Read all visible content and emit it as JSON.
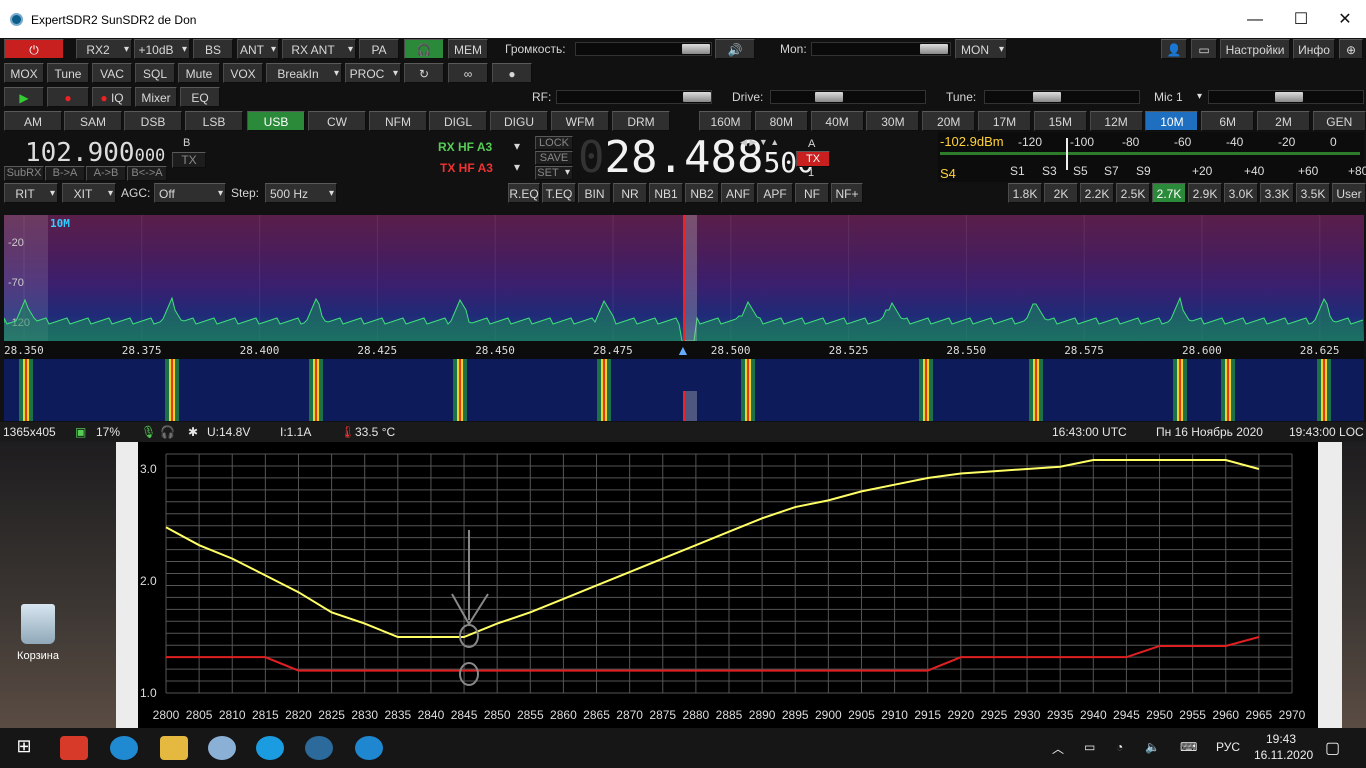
{
  "window": {
    "title": "ExpertSDR2 SunSDR2    de Don"
  },
  "row1": {
    "rx2": "RX2",
    "att": "+10dB",
    "bs": "BS",
    "ant": "ANT",
    "rxant": "RX ANT",
    "pa": "PA",
    "mem": "MEM",
    "volume_label": "Громкость:",
    "mon_label": "Mon:",
    "mon_btn": "MON",
    "settings": "Настройки",
    "info": "Инфо"
  },
  "row2": {
    "mox": "MOX",
    "tune": "Tune",
    "vac": "VAC",
    "sql": "SQL",
    "mute": "Mute",
    "vox": "VOX",
    "breakin": "BreakIn",
    "proc": "PROC"
  },
  "row3": {
    "iq": "IQ",
    "mixer": "Mixer",
    "eq": "EQ",
    "rf_label": "RF:",
    "drive_label": "Drive:",
    "tune_label": "Tune:",
    "mic": "Mic 1"
  },
  "modes": [
    "AM",
    "SAM",
    "DSB",
    "LSB",
    "USB",
    "CW",
    "NFM",
    "DIGL",
    "DIGU",
    "WFM",
    "DRM"
  ],
  "bands": [
    "160M",
    "80M",
    "40M",
    "30M",
    "20M",
    "17M",
    "15M",
    "12M",
    "10M",
    "6M",
    "2M",
    "GEN"
  ],
  "vfo": {
    "b_freq": "102.900",
    "b_freq_small": "000",
    "b_label": "B",
    "tx_small": "TX",
    "rx_hf": "RX HF",
    "rx_a": "A3",
    "tx_hf": "TX HF",
    "tx_a": "A3",
    "lock": "LOCK",
    "save": "SAVE",
    "set": "SET",
    "a_freq": "28.488",
    "a_freq_small": "500",
    "a_label": "A",
    "tx": "TX",
    "one": "1",
    "subrx": "SubRX",
    "batoa": "B->A",
    "atob": "A->B",
    "bswap": "B<->A"
  },
  "meter": {
    "dbm": "-102.9dBm",
    "scale": [
      "-120",
      "-100",
      "-80",
      "-60",
      "-40",
      "-20",
      "0"
    ],
    "s_label": "S4",
    "sunits": [
      "S1",
      "S3",
      "S5",
      "S7",
      "S9",
      "+20",
      "+40",
      "+60",
      "+80"
    ]
  },
  "row5": {
    "rit": "RIT",
    "xit": "XIT",
    "agc_label": "AGC:",
    "agc": "Off",
    "step_label": "Step:",
    "step": "500 Hz",
    "dsp": [
      "R.EQ",
      "T.EQ",
      "BIN",
      "NR",
      "NB1",
      "NB2",
      "ANF",
      "APF",
      "NF",
      "NF+"
    ],
    "filters": [
      "1.8K",
      "2K",
      "2.2K",
      "2.5K",
      "2.7K",
      "2.9K",
      "3.0K",
      "3.3K",
      "3.5K",
      "User"
    ]
  },
  "spectrum": {
    "band": "10M",
    "dbs": [
      "-20",
      "-70",
      "-120"
    ],
    "freqs": [
      "28.350",
      "28.375",
      "28.400",
      "28.425",
      "28.450",
      "28.475",
      "28.500",
      "28.525",
      "28.550",
      "28.575",
      "28.600",
      "28.625"
    ]
  },
  "status": {
    "size": "1365x405",
    "cpu": "17%",
    "voltage": "U:14.8V",
    "current": "I:1.1A",
    "temp": "33.5 °C",
    "utc": "16:43:00 UTC",
    "date": "Пн 16 Ноябрь 2020",
    "loc": "19:43:00 LOC"
  },
  "plot_text": {
    "y": [
      "3.0",
      "2.0",
      "1.0"
    ],
    "x": [
      "2800",
      "2805",
      "2810",
      "2815",
      "2820",
      "2825",
      "2830",
      "2835",
      "2840",
      "2845",
      "2850",
      "2855",
      "2860",
      "2865",
      "2870",
      "2875",
      "2880",
      "2885",
      "2890",
      "2895",
      "2900",
      "2905",
      "2910",
      "2915",
      "2920",
      "2925",
      "2930",
      "2935",
      "2940",
      "2945",
      "2950",
      "2955",
      "2960",
      "2965",
      "2970"
    ]
  },
  "chart_data": {
    "type": "line",
    "x": [
      2800,
      2805,
      2810,
      2815,
      2820,
      2825,
      2830,
      2835,
      2840,
      2845,
      2850,
      2855,
      2860,
      2865,
      2870,
      2875,
      2880,
      2885,
      2890,
      2895,
      2900,
      2905,
      2910,
      2915,
      2920,
      2925,
      2930,
      2935,
      2940,
      2945,
      2950,
      2955,
      2960,
      2965
    ],
    "series": [
      {
        "values": [
          2.48,
          2.32,
          2.2,
          2.05,
          1.9,
          1.72,
          1.62,
          1.5,
          1.5,
          1.5,
          1.62,
          1.72,
          1.84,
          1.96,
          2.08,
          2.2,
          2.32,
          2.44,
          2.56,
          2.66,
          2.72,
          2.8,
          2.86,
          2.92,
          2.96,
          2.98,
          3.0,
          3.02,
          3.08,
          3.08,
          3.08,
          3.08,
          3.08,
          3.0
        ],
        "color": "#ffff66"
      },
      {
        "values": [
          1.32,
          1.32,
          1.32,
          1.32,
          1.2,
          1.2,
          1.2,
          1.2,
          1.2,
          1.2,
          1.2,
          1.2,
          1.2,
          1.2,
          1.2,
          1.2,
          1.2,
          1.2,
          1.2,
          1.2,
          1.2,
          1.2,
          1.2,
          1.2,
          1.32,
          1.32,
          1.32,
          1.32,
          1.32,
          1.32,
          1.42,
          1.42,
          1.42,
          1.5
        ],
        "color": "#e02020"
      }
    ],
    "ylim": [
      1.0,
      3.0
    ],
    "grid": true
  },
  "desktop": {
    "recycle": "Корзина"
  },
  "taskbar": {
    "lang": "РУС",
    "time": "19:43",
    "date": "16.11.2020"
  }
}
